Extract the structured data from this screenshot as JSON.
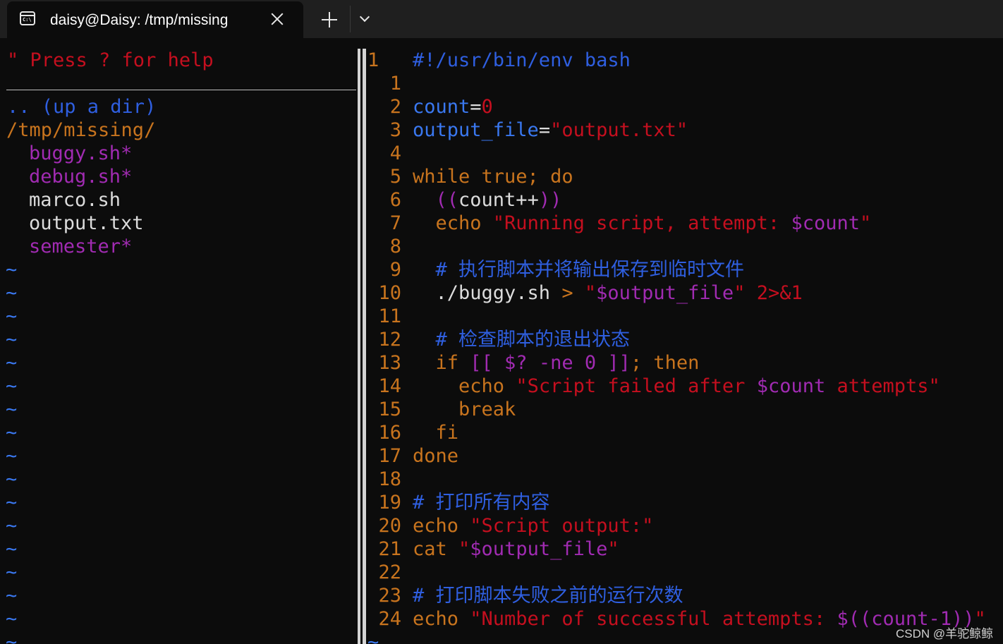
{
  "window": {
    "tab_title": "daisy@Daisy: /tmp/missing",
    "tab_icon": "terminal-icon",
    "tab_icon_text": "C:\\"
  },
  "netrw": {
    "help": "\" Press ? for help",
    "up_dir": ".. (up a dir)",
    "current_dir": "/tmp/missing/",
    "files": [
      {
        "name": "buggy.sh*",
        "executable": true
      },
      {
        "name": "debug.sh*",
        "executable": true
      },
      {
        "name": "marco.sh",
        "executable": false
      },
      {
        "name": "output.txt",
        "executable": false
      },
      {
        "name": "semester*",
        "executable": true
      }
    ],
    "tilde": "~"
  },
  "editor": {
    "line_numbers": [
      "1",
      "1",
      "2",
      "3",
      "4",
      "5",
      "6",
      "7",
      "8",
      "9",
      "10",
      "11",
      "12",
      "13",
      "14",
      "15",
      "16",
      "17",
      "18",
      "19",
      "20",
      "21",
      "22",
      "23",
      "24"
    ],
    "lines": [
      [
        [
          "#!/usr/bin/env bash",
          "cmt"
        ]
      ],
      [],
      [
        [
          "count",
          "var"
        ],
        [
          "=",
          "plain"
        ],
        [
          "0",
          "num"
        ]
      ],
      [
        [
          "output_file",
          "var"
        ],
        [
          "=",
          "plain"
        ],
        [
          "\"output.txt\"",
          "str"
        ]
      ],
      [],
      [
        [
          "while true; do",
          "kw"
        ]
      ],
      [
        [
          "  ",
          "plain"
        ],
        [
          "((",
          "pv"
        ],
        [
          "count++",
          "plain"
        ],
        [
          "))",
          "pv"
        ]
      ],
      [
        [
          "  echo ",
          "kw"
        ],
        [
          "\"Running script, attempt: ",
          "str"
        ],
        [
          "$count",
          "pv"
        ],
        [
          "\"",
          "str"
        ]
      ],
      [],
      [
        [
          "  # 执行脚本并将输出保存到临时文件",
          "cmt"
        ]
      ],
      [
        [
          "  ./buggy.sh ",
          "plain"
        ],
        [
          "> ",
          "op"
        ],
        [
          "\"",
          "str"
        ],
        [
          "$output_file",
          "pv"
        ],
        [
          "\"",
          "str"
        ],
        [
          " 2>&1",
          "num"
        ]
      ],
      [],
      [
        [
          "  # 检查脚本的退出状态",
          "cmt"
        ]
      ],
      [
        [
          "  if ",
          "kw"
        ],
        [
          "[[ $? -ne 0 ]]",
          "pv"
        ],
        [
          "; then",
          "kw"
        ]
      ],
      [
        [
          "    echo ",
          "kw"
        ],
        [
          "\"Script failed after ",
          "str"
        ],
        [
          "$count",
          "pv"
        ],
        [
          " attempts\"",
          "str"
        ]
      ],
      [
        [
          "    break",
          "kw"
        ]
      ],
      [
        [
          "  fi",
          "kw"
        ]
      ],
      [
        [
          "done",
          "kw"
        ]
      ],
      [],
      [
        [
          "# 打印所有内容",
          "cmt"
        ]
      ],
      [
        [
          "echo ",
          "kw"
        ],
        [
          "\"Script output:\"",
          "str"
        ]
      ],
      [
        [
          "cat ",
          "kw"
        ],
        [
          "\"",
          "str"
        ],
        [
          "$output_file",
          "pv"
        ],
        [
          "\"",
          "str"
        ]
      ],
      [],
      [
        [
          "# 打印脚本失败之前的运行次数",
          "cmt"
        ]
      ],
      [
        [
          "echo ",
          "kw"
        ],
        [
          "\"Number of successful attempts: ",
          "str"
        ],
        [
          "$((count-1))",
          "pv"
        ],
        [
          "\"",
          "str"
        ]
      ]
    ]
  },
  "watermark": "CSDN @羊驼鲸鲸"
}
